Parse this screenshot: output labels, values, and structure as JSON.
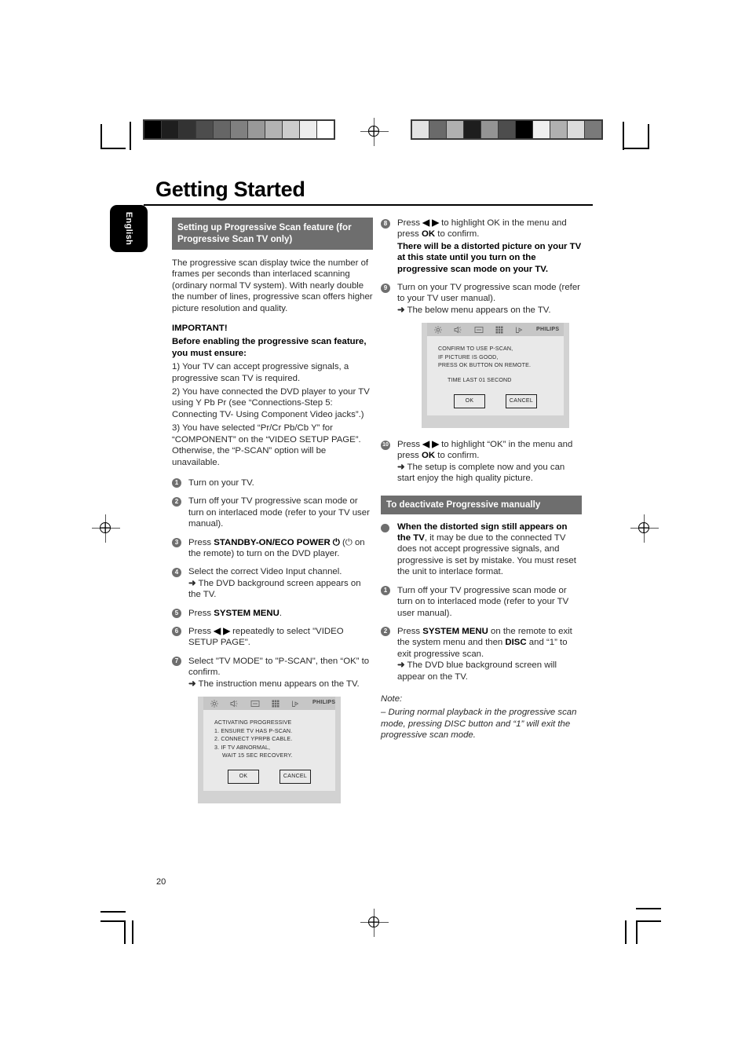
{
  "document": {
    "title": "Getting Started",
    "language_tab": "English",
    "page_number": "20"
  },
  "left_column": {
    "section_header": "Setting up Progressive Scan feature (for Progressive Scan TV only)",
    "intro": "The progressive scan display twice the number of frames per seconds than interlaced scanning (ordinary normal TV system). With nearly double the number of lines, progressive scan offers higher picture resolution and quality.",
    "important_label": "IMPORTANT!",
    "important_lead": "Before enabling the progressive scan feature, you must ensure:",
    "important_items": [
      "1) Your TV can accept progressive signals, a progressive scan TV is required.",
      "2) You have connected the DVD player to your TV using Y Pb Pr (see “Connections-Step 5: Connecting TV- Using Component Video jacks”.)",
      "3) You have selected “Pr/Cr Pb/Cb Y” for “COMPONENT” on the “VIDEO SETUP PAGE”. Otherwise, the “P-SCAN” option will be unavailable."
    ],
    "steps": [
      {
        "num": "1",
        "text": "Turn on your TV."
      },
      {
        "num": "2",
        "text": "Turn off your TV progressive scan mode or turn on interlaced mode (refer to your TV user manual)."
      },
      {
        "num": "3",
        "text_pre": "Press ",
        "bold": "STANDBY-ON/ECO POWER",
        "power_glyph": "⏻",
        "text_post": " (⏻ on the remote) to turn on the DVD player."
      },
      {
        "num": "4",
        "text": "Select the correct Video Input channel.",
        "result": "The DVD background screen appears on the TV."
      },
      {
        "num": "5",
        "text_pre": "Press ",
        "bold": "SYSTEM MENU",
        "text_post": "."
      },
      {
        "num": "6",
        "text_pre": "Press ",
        "arrows": "◀ ▶",
        "text_post": " repeatedly to select \"VIDEO SETUP PAGE\"."
      },
      {
        "num": "7",
        "text": "Select \"TV MODE\" to \"P-SCAN\", then “OK” to confirm.",
        "result": "The instruction menu appears on the TV."
      }
    ],
    "tv_screen": {
      "brand": "PHILIPS",
      "icons": [
        "settings-gear-icon",
        "speaker-icon",
        "video-display-icon",
        "grid-icon",
        "exit-arrow-icon"
      ],
      "lines": [
        "ACTIVATING PROGRESSIVE",
        "1. ENSURE TV HAS P-SCAN.",
        "2. CONNECT YPRPB CABLE.",
        "3. IF TV ABNORMAL,",
        "WAIT 15 SEC RECOVERY."
      ],
      "buttons": [
        "OK",
        "CANCEL"
      ]
    }
  },
  "right_column": {
    "steps_top": [
      {
        "num": "8",
        "text_pre": "Press ",
        "arrows": "◀ ▶",
        "text_mid": " to highlight OK in the menu and press ",
        "bold_ok": "OK",
        "text_post": " to confirm.",
        "warning": "There will be a distorted picture on your TV at this state until you turn on the progressive scan mode on your TV."
      },
      {
        "num": "9",
        "text": "Turn on your TV progressive scan mode (refer to your TV user manual).",
        "result": "The below menu appears on the TV."
      }
    ],
    "tv_screen": {
      "brand": "PHILIPS",
      "icons": [
        "settings-gear-icon",
        "speaker-icon",
        "video-display-icon",
        "grid-icon",
        "exit-arrow-icon"
      ],
      "lines": [
        "CONFIRM TO USE P-SCAN,",
        "IF PICTURE IS GOOD,",
        "PRESS OK BUTTON ON REMOTE."
      ],
      "timer_line": "TIME LAST 01 SECOND",
      "buttons": [
        "OK",
        "CANCEL"
      ]
    },
    "step_ten": {
      "num": "10",
      "text_pre": "Press ",
      "arrows": "◀ ▶",
      "text_mid": " to highlight “OK” in the menu and press ",
      "bold_ok": "OK",
      "text_post": " to confirm.",
      "result": "The setup is complete now and you can start enjoy the high quality picture."
    },
    "deactivate_header": "To deactivate Progressive manually",
    "bullet": {
      "bold": "When the distorted sign still appears on the TV",
      "rest": ", it may be due to the connected TV does not accept progressive signals, and progressive is set by mistake. You must reset the unit to interlace format."
    },
    "steps_bottom": [
      {
        "num": "1",
        "text": "Turn off your TV progressive scan mode or turn on to interlaced mode (refer to your TV user manual)."
      },
      {
        "num": "2",
        "text_pre": "Press ",
        "bold_menu": "SYSTEM MENU",
        "text_mid": " on the remote to exit the system menu and then ",
        "bold_disc": "DISC",
        "text_post": " and “1” to exit progressive scan.",
        "result": "The DVD blue background screen will appear on the TV."
      }
    ],
    "note_label": "Note:",
    "note_text": "–  During normal playback in the progressive scan mode, pressing DISC button and “1” will exit the progressive scan mode."
  },
  "print_marks": {
    "left_strip_swatches": [
      "#000000",
      "#1e1e1e",
      "#333333",
      "#4d4d4d",
      "#666666",
      "#808080",
      "#999999",
      "#b3b3b3",
      "#cccccc",
      "#ededed",
      "#ffffff"
    ],
    "right_strip_swatches": [
      "#e3e3e3",
      "#6a6a6a",
      "#b0b0b0",
      "#1e1e1e",
      "#949494",
      "#4d4d4d",
      "#000000",
      "#f0f0f0",
      "#b0b0b0",
      "#dcdcdc",
      "#7a7a7a"
    ],
    "registration_icon": "registration-target-icon"
  }
}
